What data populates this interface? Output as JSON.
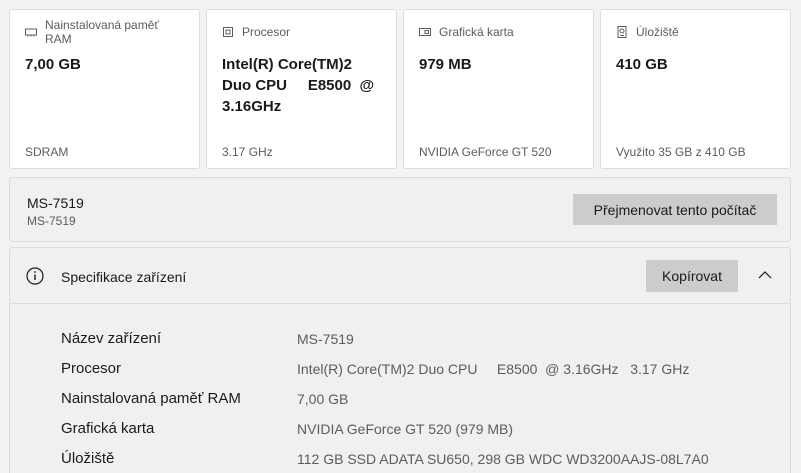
{
  "cards": [
    {
      "icon": "ram-icon",
      "title": "Nainstalovaná paměť RAM",
      "value": "7,00 GB",
      "foot": "SDRAM"
    },
    {
      "icon": "cpu-icon",
      "title": "Procesor",
      "value": "Intel(R) Core(TM)2\nDuo CPU     E8500  @\n3.16GHz",
      "foot": "3.17 GHz"
    },
    {
      "icon": "gpu-icon",
      "title": "Grafická karta",
      "value": "979 MB",
      "foot": "NVIDIA GeForce GT 520"
    },
    {
      "icon": "storage-icon",
      "title": "Úložiště",
      "value": "410 GB",
      "foot": "Využito 35 GB z 410 GB"
    }
  ],
  "device": {
    "name": "MS-7519",
    "subname": "MS-7519",
    "rename_label": "Přejmenovat tento počítač"
  },
  "specs": {
    "title": "Specifikace zařízení",
    "copy_label": "Kopírovat",
    "rows": [
      {
        "key": "Název zařízení",
        "value": "MS-7519"
      },
      {
        "key": "Procesor",
        "value": "Intel(R) Core(TM)2 Duo CPU     E8500  @ 3.16GHz   3.17 GHz"
      },
      {
        "key": "Nainstalovaná paměť RAM",
        "value": "7,00 GB"
      },
      {
        "key": "Grafická karta",
        "value": "NVIDIA GeForce GT 520 (979 MB)"
      },
      {
        "key": "Úložiště",
        "value": "112 GB SSD ADATA SU650, 298 GB WDC WD3200AAJS-08L7A0"
      }
    ]
  },
  "colors": {
    "button_bg": "#cccccc",
    "panel_bg": "#f0f0f0",
    "card_bg": "#ffffff",
    "muted_text": "#5c5c5c"
  }
}
